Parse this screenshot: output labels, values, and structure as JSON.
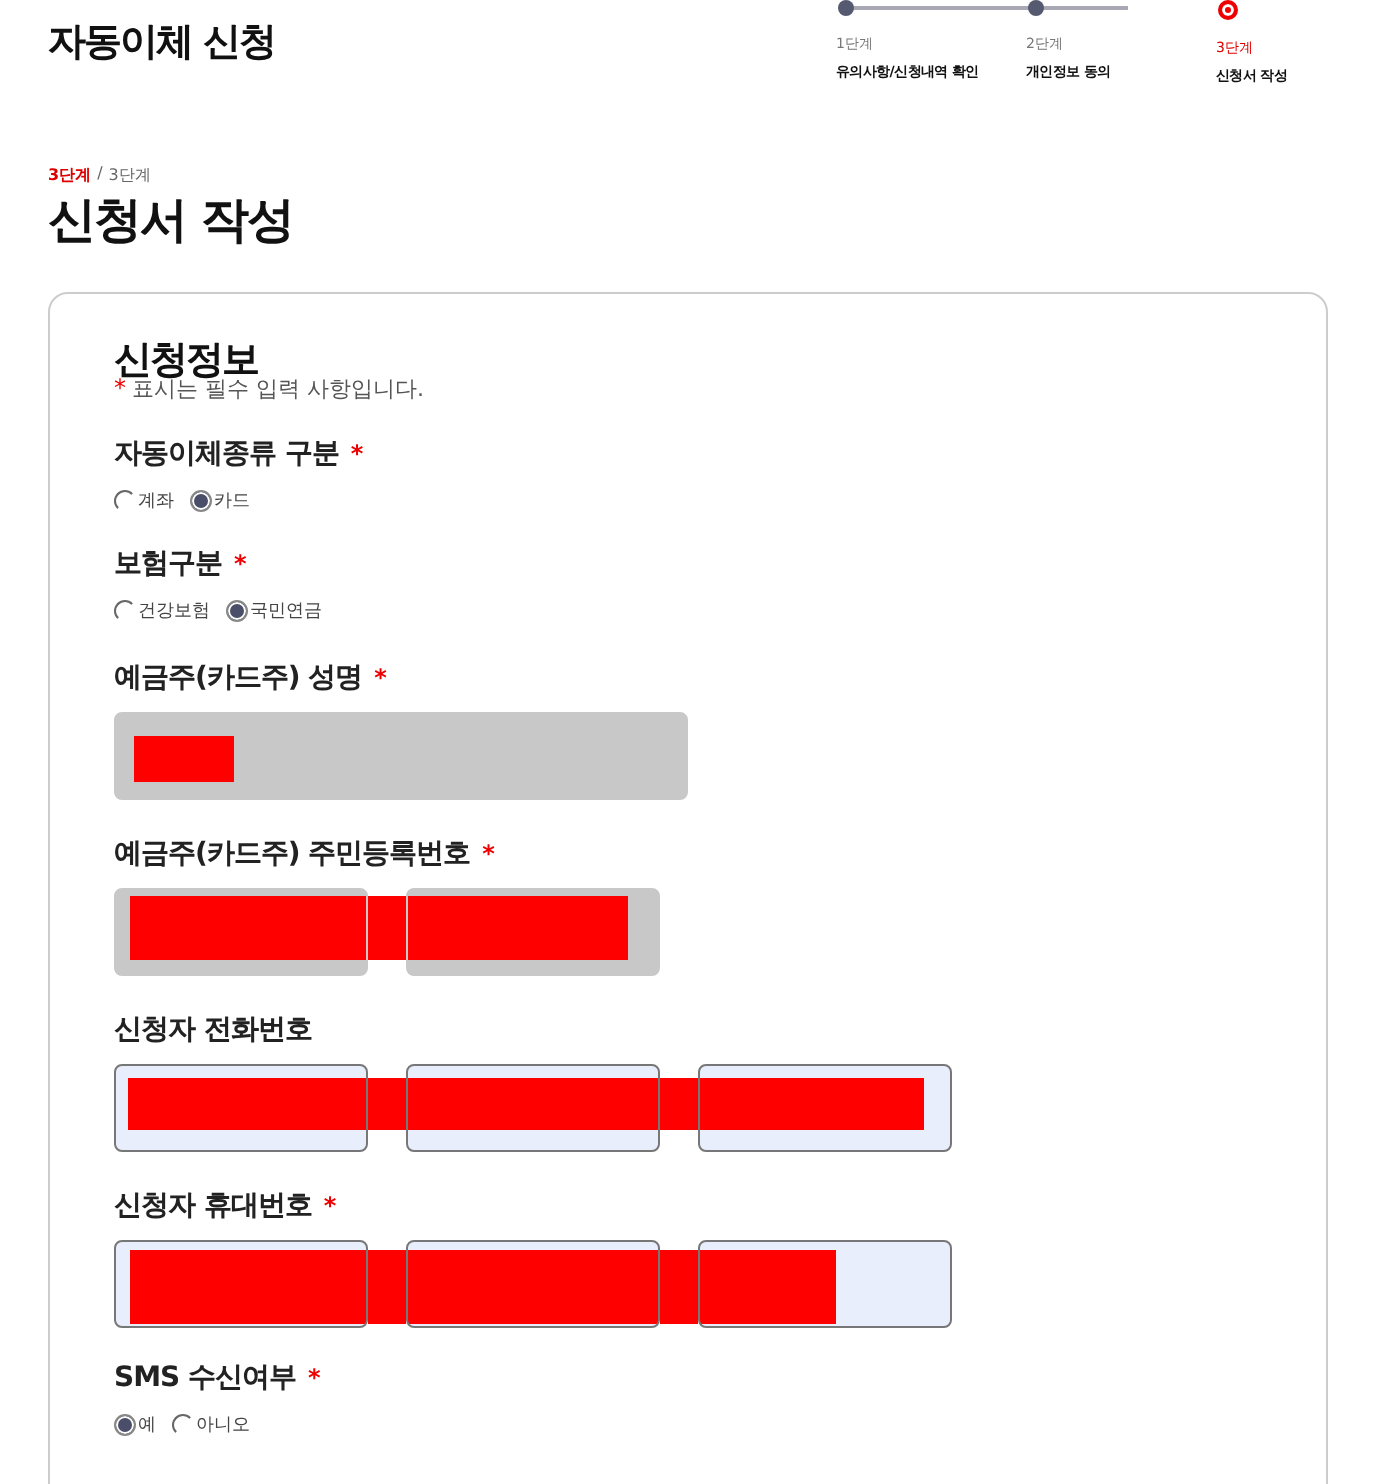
{
  "page_title": "자동이체 신청",
  "steps": [
    {
      "number": "1단계",
      "label": "유의사항/신청내역 확인",
      "selected": false
    },
    {
      "number": "2단계",
      "label": "개인정보 동의",
      "selected": false
    },
    {
      "number": "3단계",
      "label": "신청서 작성",
      "selected": true
    }
  ],
  "step_indicator": {
    "current": "3단계",
    "separator": "/",
    "total": "3단계"
  },
  "heading": "신청서 작성",
  "form": {
    "title": "신청정보",
    "required_note": {
      "mark": "*",
      "text": "표시는 필수 입력 사항입니다."
    },
    "fields": [
      {
        "kind": "radio",
        "label": "자동이체종류 구분",
        "required": true,
        "options": [
          {
            "label": "계좌",
            "selected": false
          },
          {
            "label": "카드",
            "selected": true
          }
        ]
      },
      {
        "kind": "radio",
        "label": "보험구분",
        "required": true,
        "options": [
          {
            "label": "건강보험",
            "selected": false
          },
          {
            "label": "국민연금",
            "selected": true
          }
        ]
      },
      {
        "kind": "inputs",
        "label": "예금주(카드주) 성명",
        "required": true,
        "inputs": [
          {
            "disabled": true
          }
        ],
        "redacted": true
      },
      {
        "kind": "inputs",
        "label": "예금주(카드주) 주민등록번호",
        "required": true,
        "inputs": [
          {
            "disabled": true
          },
          {
            "disabled": true
          }
        ],
        "redacted": true
      },
      {
        "kind": "inputs",
        "label": "신청자 전화번호",
        "required": false,
        "inputs": [
          {
            "disabled": false
          },
          {
            "disabled": false
          },
          {
            "disabled": false
          }
        ],
        "redacted": true
      },
      {
        "kind": "inputs",
        "label": "신청자 휴대번호",
        "required": true,
        "inputs": [
          {
            "disabled": false
          },
          {
            "disabled": false
          },
          {
            "disabled": false
          }
        ],
        "redacted": true
      },
      {
        "kind": "radio",
        "label": "SMS 수신여부",
        "required": true,
        "options": [
          {
            "label": "예",
            "selected": true
          },
          {
            "label": "아니오",
            "selected": false
          }
        ]
      }
    ]
  }
}
